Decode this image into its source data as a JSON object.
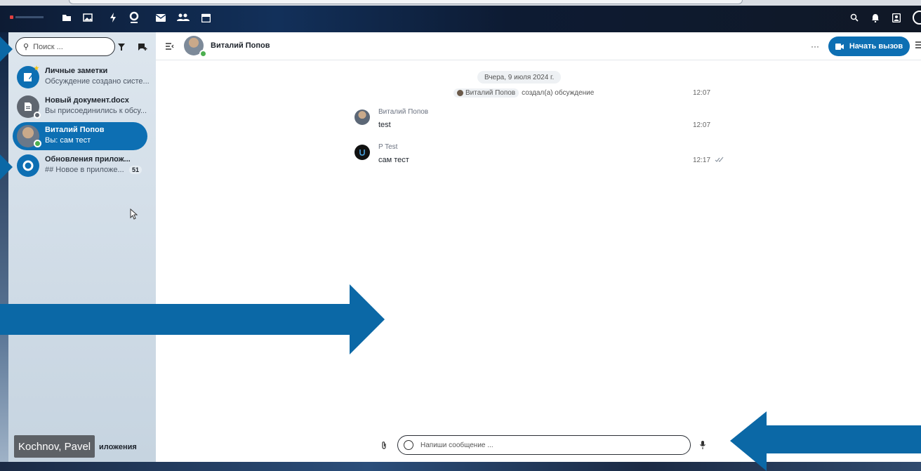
{
  "topbar": {
    "apps": [
      "files-icon",
      "photos-icon",
      "activity-icon",
      "talk-icon",
      "mail-icon",
      "contacts-icon",
      "calendar-icon"
    ],
    "right_icons": [
      "search-icon",
      "bell-icon",
      "contacts-menu-icon"
    ]
  },
  "sidebar": {
    "search_placeholder": "Поиск ...",
    "conversations": [
      {
        "name": "Личные заметки",
        "subtitle": "Обсуждение создано систе...",
        "badge": "",
        "active": false
      },
      {
        "name": "Новый документ.docx",
        "subtitle": "Вы присоединились к обсу...",
        "badge": "",
        "active": false
      },
      {
        "name": "Виталий Попов",
        "subtitle": "Вы: сам тест",
        "badge": "",
        "active": true
      },
      {
        "name": "Обновления прилож...",
        "subtitle": "## Новое в приложе...",
        "badge": "51",
        "active": false
      }
    ],
    "bottom_link": "иложения",
    "presenter_tag": "Kochnov, Pavel"
  },
  "chat": {
    "title": "Виталий Попов",
    "call_label": "Начать вызов",
    "date_separator": "Вчера, 9 июля 2024 г.",
    "system_message": {
      "actor": "Виталий Попов",
      "text": "создал(а) обсуждение",
      "time": "12:07"
    },
    "messages": [
      {
        "author": "Виталий Попов",
        "text": "test",
        "time": "12:07"
      },
      {
        "author": "P Test",
        "text": "сам тест",
        "time": "12:17"
      }
    ],
    "composer_placeholder": "Напиши сообщение ..."
  },
  "colors": {
    "accent": "#0d6fb3",
    "arrow": "#0b68a6",
    "online": "#4caf50"
  }
}
